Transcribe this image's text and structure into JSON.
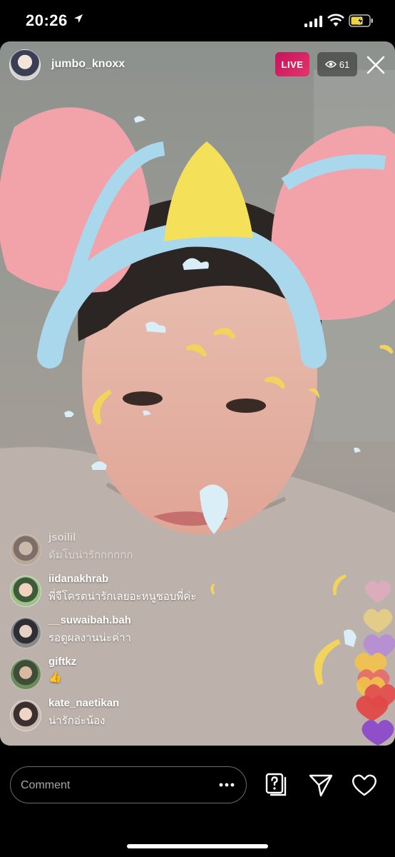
{
  "status_bar": {
    "time": "20:26"
  },
  "stream": {
    "host_username": "jumbo_knoxx",
    "live_label": "LIVE",
    "viewer_count": "61"
  },
  "comments": [
    {
      "username": "jsoilil",
      "text": "ดัมโบน่ารักกกกกก"
    },
    {
      "username": "iidanakhrab",
      "text": "พี่จีโครตน่ารักเลยอะหนูชอบพี่ค่ะ"
    },
    {
      "username": "__suwaibah.bah",
      "text": "รอดูผลงานน่ะค่าา"
    },
    {
      "username": "giftkz",
      "text": "👍"
    },
    {
      "username": "kate_naetikan",
      "text": "น่ารักอ่ะน้อง"
    }
  ],
  "comment_bar": {
    "placeholder": "Comment"
  },
  "colors": {
    "live_badge": "#d81b60",
    "ear_pink": "#f2a3aa",
    "headband_blue": "#a9d8ec",
    "crown_yellow": "#f5e05a",
    "moon_yellow": "#f2d35b"
  },
  "icons": [
    "location-arrow-icon",
    "signal-icon",
    "wifi-icon",
    "battery-icon",
    "eye-icon",
    "close-icon",
    "more-icon",
    "question-icon",
    "send-icon",
    "heart-icon"
  ]
}
